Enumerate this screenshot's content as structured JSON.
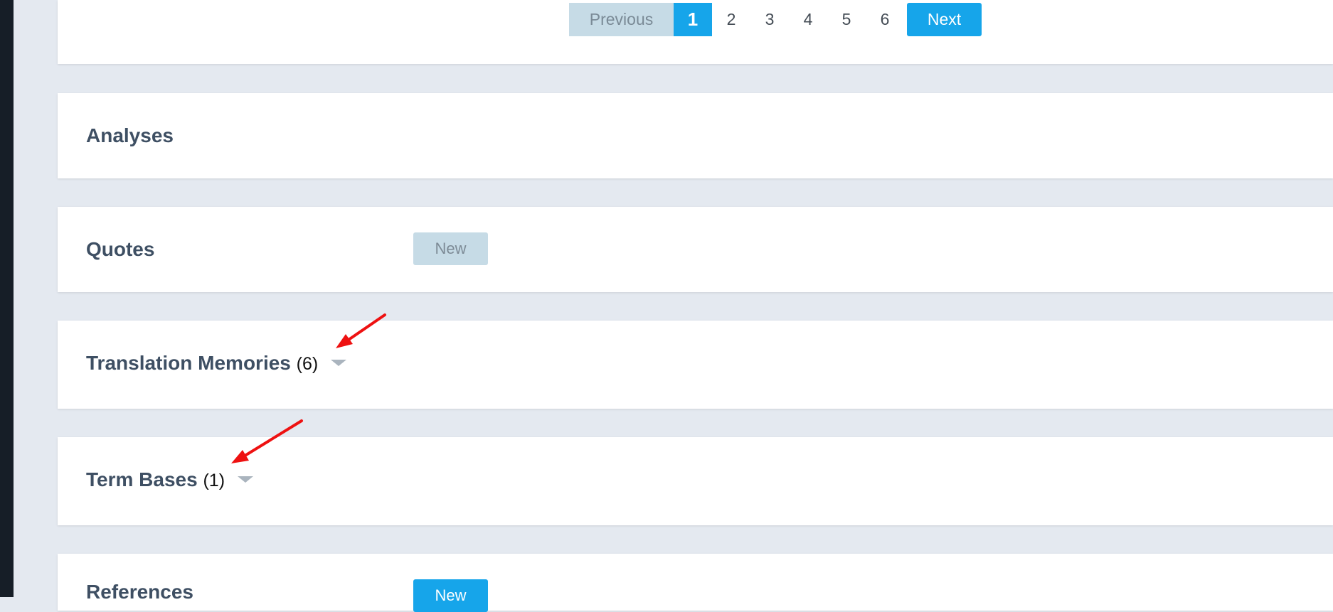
{
  "pagination": {
    "previous_label": "Previous",
    "pages": [
      "1",
      "2",
      "3",
      "4",
      "5",
      "6"
    ],
    "active_page": "1",
    "next_label": "Next"
  },
  "sections": {
    "analyses": {
      "title": "Analyses"
    },
    "quotes": {
      "title": "Quotes",
      "new_label": "New"
    },
    "translation_memories": {
      "title": "Translation Memories",
      "count": "(6)"
    },
    "term_bases": {
      "title": "Term Bases",
      "count": "(1)"
    },
    "references": {
      "title": "References",
      "new_label": "New"
    }
  },
  "colors": {
    "accent": "#16a5ea",
    "disabled_button": "#c6dbe6",
    "page_background": "#e4e9f0",
    "heading_text": "#3e4f63",
    "annotation_arrow": "#ee1111"
  },
  "icons": {
    "dropdown": "caret-down-icon",
    "annotation": "red-arrow-annotation"
  }
}
